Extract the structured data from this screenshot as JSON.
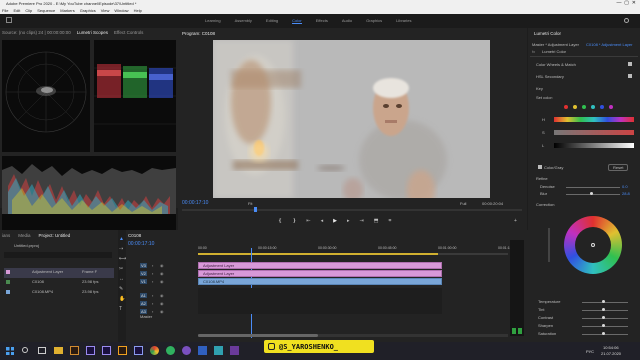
{
  "app": {
    "title": "Adobe Premiere Pro 2020 - E:\\My YouTube channel\\Episode\\37\\Untitled *"
  },
  "menu": [
    "File",
    "Edit",
    "Clip",
    "Sequence",
    "Markers",
    "Graphics",
    "View",
    "Window",
    "Help"
  ],
  "workspaces": [
    "Learning",
    "Assembly",
    "Editing",
    "Color",
    "Effects",
    "Audio",
    "Graphics",
    "Libraries"
  ],
  "workspace_active": "Color",
  "source_panel": {
    "tabs": [
      "Source: (no clips) 24 | 00:00:00:00",
      "Lumetri Scopes",
      "Effect Controls"
    ]
  },
  "program": {
    "title": "Program: C0108",
    "timecode": "00:00:17:10",
    "fit": "Fit",
    "quality": "Full",
    "duration": "00:00:20:04"
  },
  "project": {
    "tabs": [
      "ians",
      "Media",
      "Project: Untitled"
    ],
    "filename": "Untitled.prproj",
    "items": [
      {
        "name": "Adjustment Layer",
        "tag": "Frame F"
      },
      {
        "name": "C0108",
        "tag": "23.98 fps"
      },
      {
        "name": "C0108.MP4",
        "tag": "23.98 fps"
      }
    ]
  },
  "timeline": {
    "tab": "C0108",
    "timecode": "00:00:17:10",
    "rulers": [
      "00:00",
      "00:00:15:00",
      "00:00:30:00",
      "00:00:45:00",
      "00:01:00:00",
      "00:01:15:00"
    ],
    "tracks_v": [
      "V3",
      "V2",
      "V1"
    ],
    "tracks_a": [
      "A1",
      "A2",
      "A3"
    ],
    "master": "Master",
    "clips": [
      "Adjustment Layer",
      "Adjustment Layer",
      "C0108.MP4"
    ]
  },
  "lumetri": {
    "tab": "Lumetri Color",
    "master": "Master * Adjustment Layer",
    "clip": "C0108 * Adjustment Layer",
    "fx": "Lumetri Color",
    "sections": [
      "Color Wheels & Match",
      "HSL Secondary",
      "Key",
      "Refine",
      "Correction"
    ],
    "key": {
      "set_color": "Set color:",
      "rows": [
        "H",
        "S",
        "L"
      ]
    },
    "color_gray": "Color/Gray",
    "reset": "Reset",
    "refine": {
      "denoise": "Denoise",
      "denoise_val": "0.0",
      "blur": "Blur",
      "blur_val": "28.8"
    },
    "adjust": [
      "Temperature",
      "Tint",
      "Contrast",
      "Sharpen",
      "Saturation"
    ]
  },
  "taskbar": {
    "time": "10:54:06",
    "date": "21.07.2020",
    "lang": "РУС"
  },
  "watermark": "@S_YAROSHENKO_"
}
